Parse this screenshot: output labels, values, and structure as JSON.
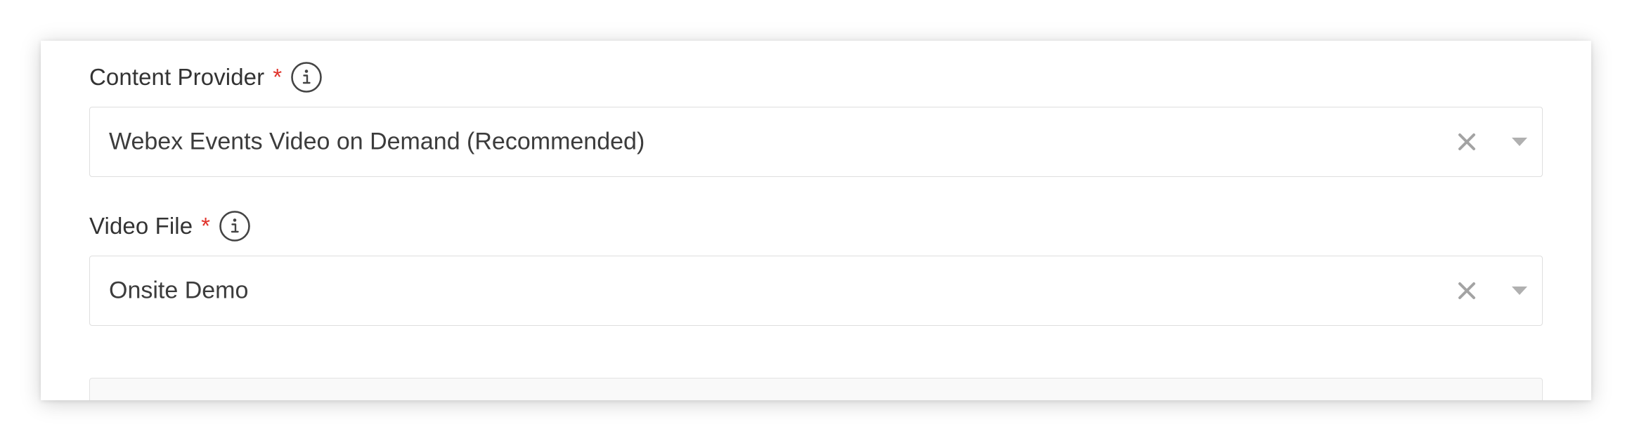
{
  "form": {
    "content_provider": {
      "label": "Content Provider",
      "required_mark": "*",
      "value": "Webex Events Video on Demand (Recommended)"
    },
    "video_file": {
      "label": "Video File",
      "required_mark": "*",
      "value": "Onsite Demo"
    }
  },
  "colors": {
    "required": "#e0332b",
    "border": "#dedede",
    "text": "#333333",
    "icon": "#9a9a9a"
  },
  "icons": {
    "info": "info-icon",
    "clear": "close-icon",
    "dropdown": "chevron-down-icon"
  }
}
